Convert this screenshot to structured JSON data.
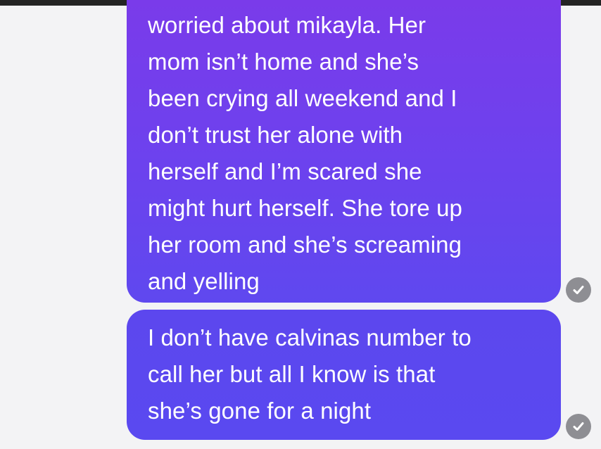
{
  "messages": [
    {
      "lines": [
        "worried about mikayla. Her",
        "mom isn’t home and she’s",
        "been crying all weekend and I",
        "don’t trust her alone with",
        "herself and I’m scared she",
        "might hurt herself. She tore up",
        "her room and she’s screaming",
        "and yelling"
      ],
      "status_icon": "check-circle-icon"
    },
    {
      "lines": [
        "I don’t have calvinas number to",
        "call her but all I know is that",
        "she’s gone for a night"
      ],
      "status_icon": "check-circle-icon"
    }
  ],
  "colors": {
    "bubble_top": "#7a3bea",
    "bubble_bottom": "#5a49f0",
    "receipt": "#8e8e93",
    "background": "#f3f3f5"
  }
}
